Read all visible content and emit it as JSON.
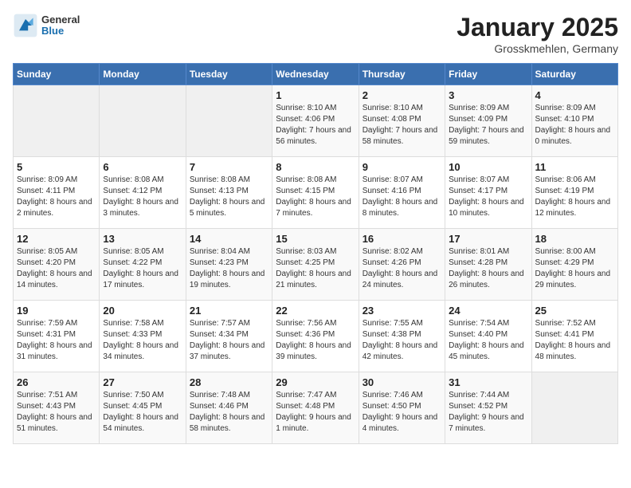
{
  "header": {
    "logo_general": "General",
    "logo_blue": "Blue",
    "title": "January 2025",
    "subtitle": "Grosskmehlen, Germany"
  },
  "days_of_week": [
    "Sunday",
    "Monday",
    "Tuesday",
    "Wednesday",
    "Thursday",
    "Friday",
    "Saturday"
  ],
  "weeks": [
    [
      {
        "day": "",
        "info": ""
      },
      {
        "day": "",
        "info": ""
      },
      {
        "day": "",
        "info": ""
      },
      {
        "day": "1",
        "info": "Sunrise: 8:10 AM\nSunset: 4:06 PM\nDaylight: 7 hours and 56 minutes."
      },
      {
        "day": "2",
        "info": "Sunrise: 8:10 AM\nSunset: 4:08 PM\nDaylight: 7 hours and 58 minutes."
      },
      {
        "day": "3",
        "info": "Sunrise: 8:09 AM\nSunset: 4:09 PM\nDaylight: 7 hours and 59 minutes."
      },
      {
        "day": "4",
        "info": "Sunrise: 8:09 AM\nSunset: 4:10 PM\nDaylight: 8 hours and 0 minutes."
      }
    ],
    [
      {
        "day": "5",
        "info": "Sunrise: 8:09 AM\nSunset: 4:11 PM\nDaylight: 8 hours and 2 minutes."
      },
      {
        "day": "6",
        "info": "Sunrise: 8:08 AM\nSunset: 4:12 PM\nDaylight: 8 hours and 3 minutes."
      },
      {
        "day": "7",
        "info": "Sunrise: 8:08 AM\nSunset: 4:13 PM\nDaylight: 8 hours and 5 minutes."
      },
      {
        "day": "8",
        "info": "Sunrise: 8:08 AM\nSunset: 4:15 PM\nDaylight: 8 hours and 7 minutes."
      },
      {
        "day": "9",
        "info": "Sunrise: 8:07 AM\nSunset: 4:16 PM\nDaylight: 8 hours and 8 minutes."
      },
      {
        "day": "10",
        "info": "Sunrise: 8:07 AM\nSunset: 4:17 PM\nDaylight: 8 hours and 10 minutes."
      },
      {
        "day": "11",
        "info": "Sunrise: 8:06 AM\nSunset: 4:19 PM\nDaylight: 8 hours and 12 minutes."
      }
    ],
    [
      {
        "day": "12",
        "info": "Sunrise: 8:05 AM\nSunset: 4:20 PM\nDaylight: 8 hours and 14 minutes."
      },
      {
        "day": "13",
        "info": "Sunrise: 8:05 AM\nSunset: 4:22 PM\nDaylight: 8 hours and 17 minutes."
      },
      {
        "day": "14",
        "info": "Sunrise: 8:04 AM\nSunset: 4:23 PM\nDaylight: 8 hours and 19 minutes."
      },
      {
        "day": "15",
        "info": "Sunrise: 8:03 AM\nSunset: 4:25 PM\nDaylight: 8 hours and 21 minutes."
      },
      {
        "day": "16",
        "info": "Sunrise: 8:02 AM\nSunset: 4:26 PM\nDaylight: 8 hours and 24 minutes."
      },
      {
        "day": "17",
        "info": "Sunrise: 8:01 AM\nSunset: 4:28 PM\nDaylight: 8 hours and 26 minutes."
      },
      {
        "day": "18",
        "info": "Sunrise: 8:00 AM\nSunset: 4:29 PM\nDaylight: 8 hours and 29 minutes."
      }
    ],
    [
      {
        "day": "19",
        "info": "Sunrise: 7:59 AM\nSunset: 4:31 PM\nDaylight: 8 hours and 31 minutes."
      },
      {
        "day": "20",
        "info": "Sunrise: 7:58 AM\nSunset: 4:33 PM\nDaylight: 8 hours and 34 minutes."
      },
      {
        "day": "21",
        "info": "Sunrise: 7:57 AM\nSunset: 4:34 PM\nDaylight: 8 hours and 37 minutes."
      },
      {
        "day": "22",
        "info": "Sunrise: 7:56 AM\nSunset: 4:36 PM\nDaylight: 8 hours and 39 minutes."
      },
      {
        "day": "23",
        "info": "Sunrise: 7:55 AM\nSunset: 4:38 PM\nDaylight: 8 hours and 42 minutes."
      },
      {
        "day": "24",
        "info": "Sunrise: 7:54 AM\nSunset: 4:40 PM\nDaylight: 8 hours and 45 minutes."
      },
      {
        "day": "25",
        "info": "Sunrise: 7:52 AM\nSunset: 4:41 PM\nDaylight: 8 hours and 48 minutes."
      }
    ],
    [
      {
        "day": "26",
        "info": "Sunrise: 7:51 AM\nSunset: 4:43 PM\nDaylight: 8 hours and 51 minutes."
      },
      {
        "day": "27",
        "info": "Sunrise: 7:50 AM\nSunset: 4:45 PM\nDaylight: 8 hours and 54 minutes."
      },
      {
        "day": "28",
        "info": "Sunrise: 7:48 AM\nSunset: 4:46 PM\nDaylight: 8 hours and 58 minutes."
      },
      {
        "day": "29",
        "info": "Sunrise: 7:47 AM\nSunset: 4:48 PM\nDaylight: 9 hours and 1 minute."
      },
      {
        "day": "30",
        "info": "Sunrise: 7:46 AM\nSunset: 4:50 PM\nDaylight: 9 hours and 4 minutes."
      },
      {
        "day": "31",
        "info": "Sunrise: 7:44 AM\nSunset: 4:52 PM\nDaylight: 9 hours and 7 minutes."
      },
      {
        "day": "",
        "info": ""
      }
    ]
  ]
}
